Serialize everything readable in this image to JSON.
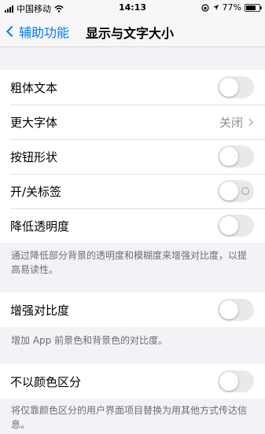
{
  "status": {
    "carrier": "中国移动",
    "time": "14:13",
    "battery": "77%",
    "battery_level": 0.77,
    "icons": [
      "signal-icon",
      "wifi-icon",
      "lock-rotation-icon",
      "location-icon",
      "battery-icon"
    ]
  },
  "nav": {
    "back_label": "辅助功能",
    "title": "显示与文字大小"
  },
  "group1": {
    "bold_text": {
      "label": "粗体文本",
      "on": false
    },
    "larger_text": {
      "label": "更大字体",
      "value": "关闭"
    },
    "button_shapes": {
      "label": "按钮形状",
      "on": false
    },
    "onoff_labels": {
      "label": "开/关标签",
      "on": false
    },
    "reduce_transparency": {
      "label": "降低透明度",
      "on": false
    },
    "footer": "通过降低部分背景的透明度和模糊度来增强对比度，以提高易读性。"
  },
  "group2": {
    "increase_contrast": {
      "label": "增强对比度",
      "on": false
    },
    "footer": "增加 App 前景色和背景色的对比度。"
  },
  "group3": {
    "differentiate_without_color": {
      "label": "不以颜色区分",
      "on": false
    },
    "footer": "将仅靠颜色区分的用户界面项目替换为用其他方式传达信息。"
  },
  "colors": {
    "accent": "#007aff",
    "background": "#f2f2f7",
    "toggle_off": "#e9e9ea"
  }
}
